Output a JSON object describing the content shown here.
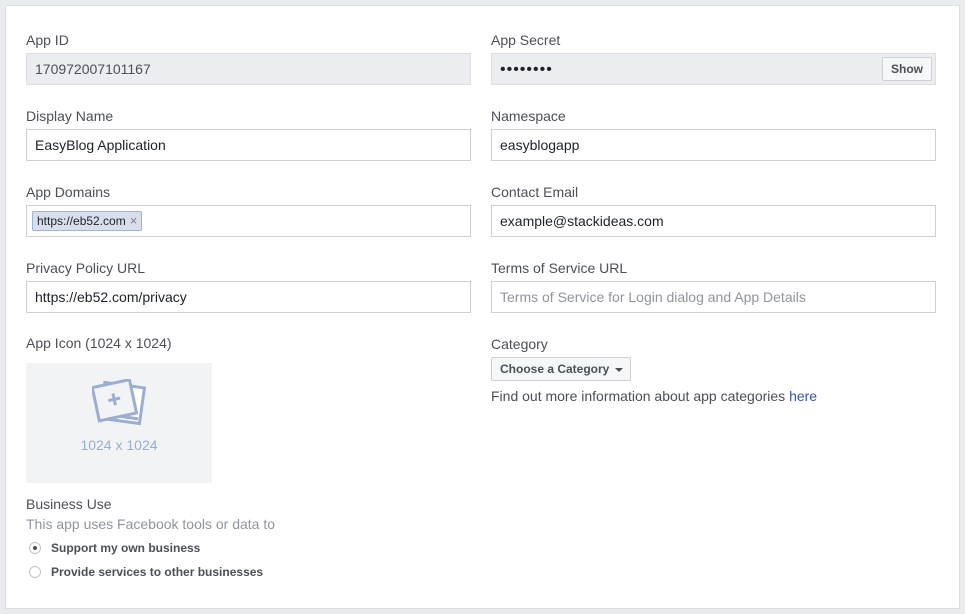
{
  "app_id": {
    "label": "App ID",
    "value": "170972007101167"
  },
  "app_secret": {
    "label": "App Secret",
    "value": "••••••••",
    "show_label": "Show"
  },
  "display_name": {
    "label": "Display Name",
    "value": "EasyBlog Application"
  },
  "namespace": {
    "label": "Namespace",
    "value": "easyblogapp"
  },
  "app_domains": {
    "label": "App Domains",
    "tags": [
      "https://eb52.com"
    ],
    "remove_glyph": "×"
  },
  "contact_email": {
    "label": "Contact Email",
    "value": "example@stackideas.com"
  },
  "privacy_policy": {
    "label": "Privacy Policy URL",
    "value": "https://eb52.com/privacy"
  },
  "terms_of_service": {
    "label": "Terms of Service URL",
    "placeholder": "Terms of Service for Login dialog and App Details"
  },
  "app_icon": {
    "label": "App Icon (1024 x 1024)",
    "caption": "1024 x 1024",
    "icon": "image-upload-icon"
  },
  "category": {
    "label": "Category",
    "select_label": "Choose a Category",
    "info_text": "Find out more information about app categories ",
    "info_link": "here"
  },
  "business_use": {
    "label": "Business Use",
    "description": "This app uses Facebook tools or data to",
    "options": [
      {
        "label": "Support my own business",
        "selected": true
      },
      {
        "label": "Provide services to other businesses",
        "selected": false
      }
    ]
  },
  "colors": {
    "link": "#365899",
    "tag_bg": "#d8dfea",
    "disabled_bg": "#ebedf0"
  }
}
